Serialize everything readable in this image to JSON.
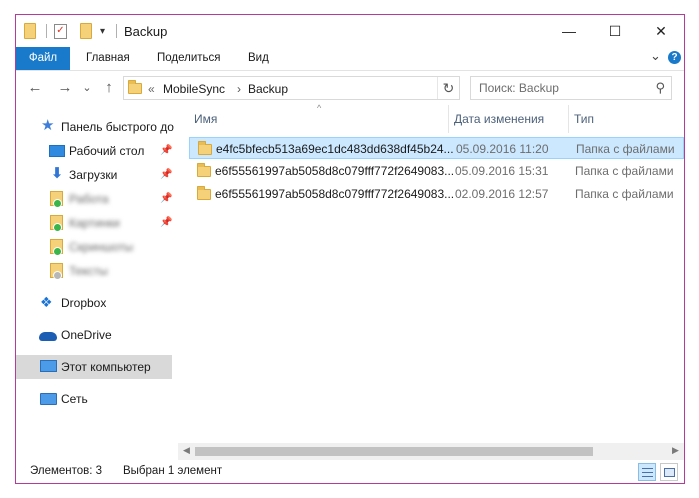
{
  "window": {
    "title": "Backup",
    "controls": {
      "minimize": "—",
      "maximize": "☐",
      "close": "✕"
    }
  },
  "ribbon": {
    "tabs": [
      "Файл",
      "Главная",
      "Поделиться",
      "Вид"
    ],
    "expand_glyph": "⌄",
    "help_glyph": "?"
  },
  "navigation": {
    "back_glyph": "←",
    "forward_glyph": "→",
    "recent_glyph": "⌄",
    "up_glyph": "↑",
    "breadcrumb": {
      "overflow": "«",
      "items": [
        "MobileSync",
        "Backup"
      ],
      "separator": "›"
    },
    "refresh_glyph": "↻",
    "search_placeholder": "Поиск: Backup",
    "search_glyph": "⚲"
  },
  "sidebar": {
    "items": [
      {
        "label": "Панель быстрого доступа",
        "icon": "star-icon"
      },
      {
        "label": "Рабочий стол",
        "icon": "desktop-icon",
        "pinned": true
      },
      {
        "label": "Загрузки",
        "icon": "download-icon",
        "pinned": true
      },
      {
        "label": "Работа",
        "icon": "folder-icon",
        "pinned": true,
        "blurred": true
      },
      {
        "label": "Картинки",
        "icon": "folder-icon",
        "pinned": true,
        "blurred": true
      },
      {
        "label": "Скриншоты",
        "icon": "folder-icon",
        "blurred": true
      },
      {
        "label": "Тексты",
        "icon": "folder-icon",
        "blurred": true
      },
      {
        "label": "Dropbox",
        "icon": "dropbox-icon"
      },
      {
        "label": "OneDrive",
        "icon": "cloud-icon"
      },
      {
        "label": "Этот компьютер",
        "icon": "computer-icon",
        "selected": true
      },
      {
        "label": "Сеть",
        "icon": "network-icon"
      }
    ],
    "pin_glyph": "📌"
  },
  "columns": {
    "name": "Имя",
    "date": "Дата изменения",
    "type": "Тип",
    "sort_glyph": "^"
  },
  "files": [
    {
      "name": "e4fc5bfecb513a69ec1dc483dd638df45b24...",
      "date": "05.09.2016 11:20",
      "type": "Папка с файлами",
      "selected": true
    },
    {
      "name": "e6f55561997ab5058d8c079fff772f2649083...",
      "date": "05.09.2016 15:31",
      "type": "Папка с файлами",
      "selected": false
    },
    {
      "name": "e6f55561997ab5058d8c079fff772f2649083...",
      "date": "02.09.2016 12:57",
      "type": "Папка с файлами",
      "selected": false
    }
  ],
  "scrollbar": {
    "left_glyph": "◀",
    "right_glyph": "▶"
  },
  "statusbar": {
    "count": "Элементов: 3",
    "selection": "Выбран 1 элемент"
  },
  "colors": {
    "accent": "#1979ca",
    "selection_bg": "#cce8ff",
    "selection_border": "#99d1ff",
    "window_border": "#b53a9a"
  }
}
